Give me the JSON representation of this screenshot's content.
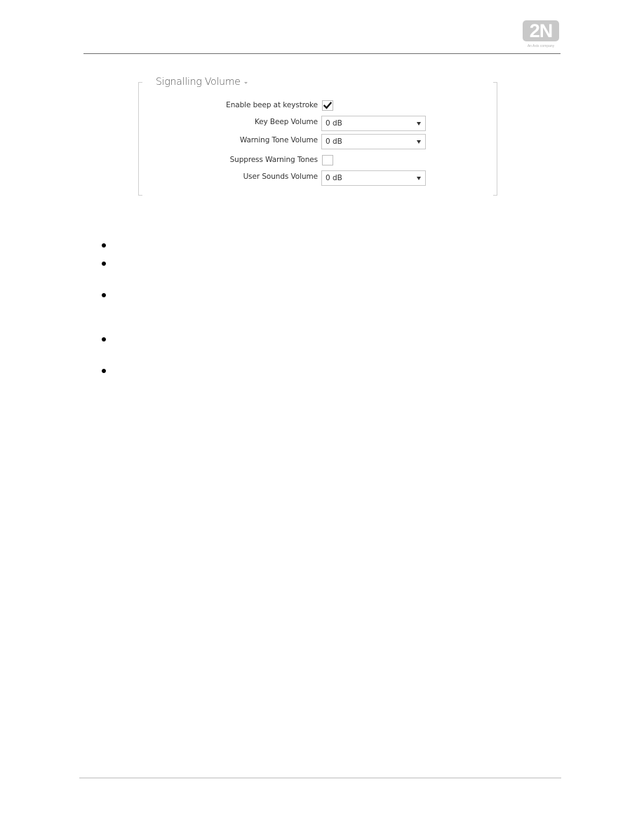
{
  "header": {
    "logo_text": "2N",
    "logo_tagline": "An Axis company"
  },
  "section": {
    "title": "Signalling Volume",
    "collapse_icon": "chevron-down-icon",
    "fields": [
      {
        "label": "Enable beep at keystroke",
        "type": "checkbox",
        "checked": true
      },
      {
        "label": "Key Beep Volume",
        "type": "select",
        "value": "0 dB"
      },
      {
        "label": "Warning Tone Volume",
        "type": "select",
        "value": "0 dB"
      },
      {
        "label": "Suppress Warning Tones",
        "type": "checkbox",
        "checked": false
      },
      {
        "label": "User Sounds Volume",
        "type": "select",
        "value": "0 dB"
      }
    ]
  },
  "bullets": {
    "count": 5
  },
  "colors": {
    "logo_bg": "#c8c8c8",
    "rule_header": "#6e6e6e",
    "rule_footer": "#bdbdbd",
    "bracket": "#d0d0d0"
  }
}
